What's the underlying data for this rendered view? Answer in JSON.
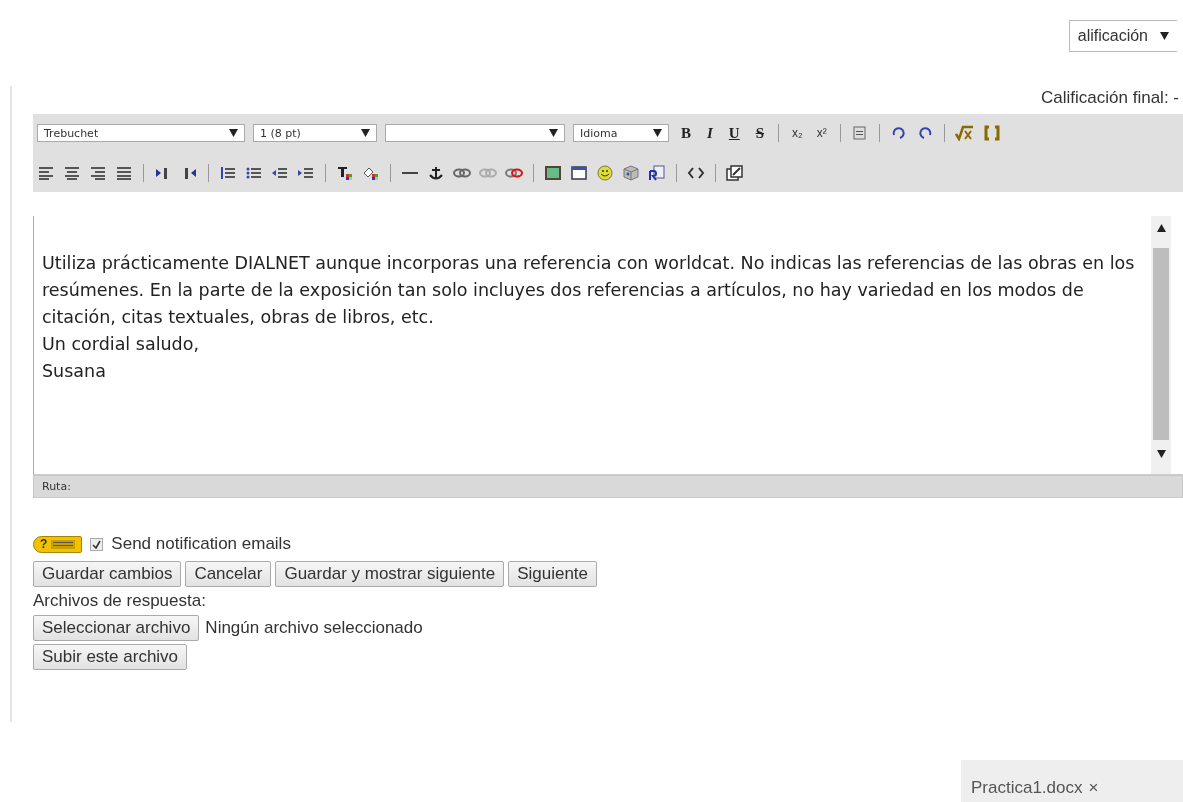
{
  "grade_select": {
    "value": "alificación"
  },
  "final_grade": "Calificación final: -",
  "toolbar": {
    "font": "Trebuchet",
    "size": "1 (8 pt)",
    "language": "Idioma",
    "format_glyphs": [
      "B",
      "I",
      "U",
      "S"
    ],
    "script_glyphs": [
      "x₂",
      "x²"
    ]
  },
  "editor": {
    "paragraphs": [
      "Utiliza prácticamente DIALNET aunque incorporas una referencia con worldcat. No indicas las referencias de las obras en los resúmenes. En la parte de la exposición tan solo incluyes dos referencias a artículos, no hay variedad en los modos de citación, citas textuales, obras de libros, etc.",
      "Un cordial saludo,",
      "Susana"
    ]
  },
  "path_bar": "Ruta:",
  "help_badge": "?",
  "notify": {
    "label": "Send notification emails",
    "checked": true
  },
  "buttons": [
    "Guardar cambios",
    "Cancelar",
    "Guardar y mostrar siguiente",
    "Siguiente"
  ],
  "files_label": "Archivos de respuesta:",
  "file_button": "Seleccionar archivo",
  "file_status": "Ningún archivo seleccionado",
  "upload_button": "Subir este archivo",
  "attachment": {
    "name": "Practica1.docx",
    "close": "×"
  }
}
